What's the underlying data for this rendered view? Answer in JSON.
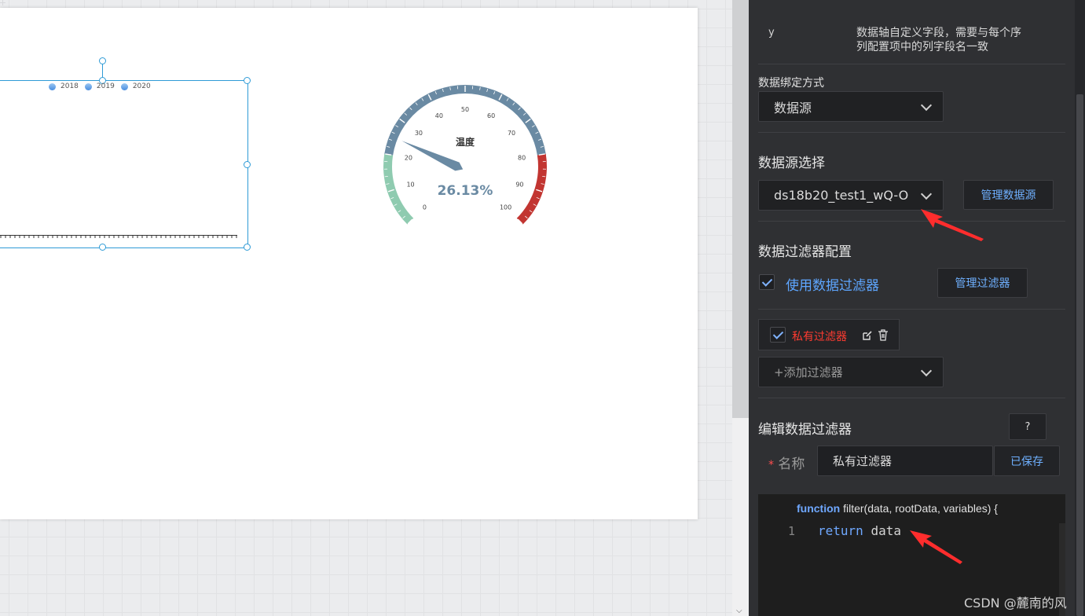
{
  "canvas": {
    "legend": [
      "2018",
      "2019",
      "2020"
    ],
    "gauge": {
      "title": "温度",
      "value_text": "26.13%",
      "value": 26.13,
      "min": 0,
      "max": 100,
      "ticks": [
        "0",
        "10",
        "20",
        "30",
        "40",
        "50",
        "60",
        "70",
        "80",
        "90",
        "100"
      ],
      "colors": {
        "low": "#8fcbb0",
        "mid": "#6a8aa3",
        "high": "#c23531",
        "value": "#6a8aa3"
      }
    }
  },
  "panel": {
    "field_name": "y",
    "field_desc_line1": "数据轴自定义字段，需要与每个序",
    "field_desc_line2": "列配置项中的列字段名一致",
    "binding_label": "数据绑定方式",
    "binding_value": "数据源",
    "datasource_label": "数据源选择",
    "datasource_value": "ds18b20_test1_wQ-O",
    "manage_datasource": "管理数据源",
    "filter_config_label": "数据过滤器配置",
    "use_filter_label": "使用数据过滤器",
    "manage_filter": "管理过滤器",
    "private_filter_label": "私有过滤器",
    "add_filter_placeholder": "+添加过滤器",
    "edit_filter_label": "编辑数据过滤器",
    "help_label": "?",
    "name_required_mark": "*",
    "name_label": "名称",
    "name_value": "私有过滤器",
    "saved_label": "已保存",
    "code_keyword": "function",
    "code_signature": " filter(data, rootData, variables) {",
    "code_line_number": "1",
    "code_return": "return",
    "code_data": "data",
    "accent_color": "#6fb0ff",
    "private_filter_color": "#ff3b30"
  },
  "watermark": "CSDN @麓南的风"
}
